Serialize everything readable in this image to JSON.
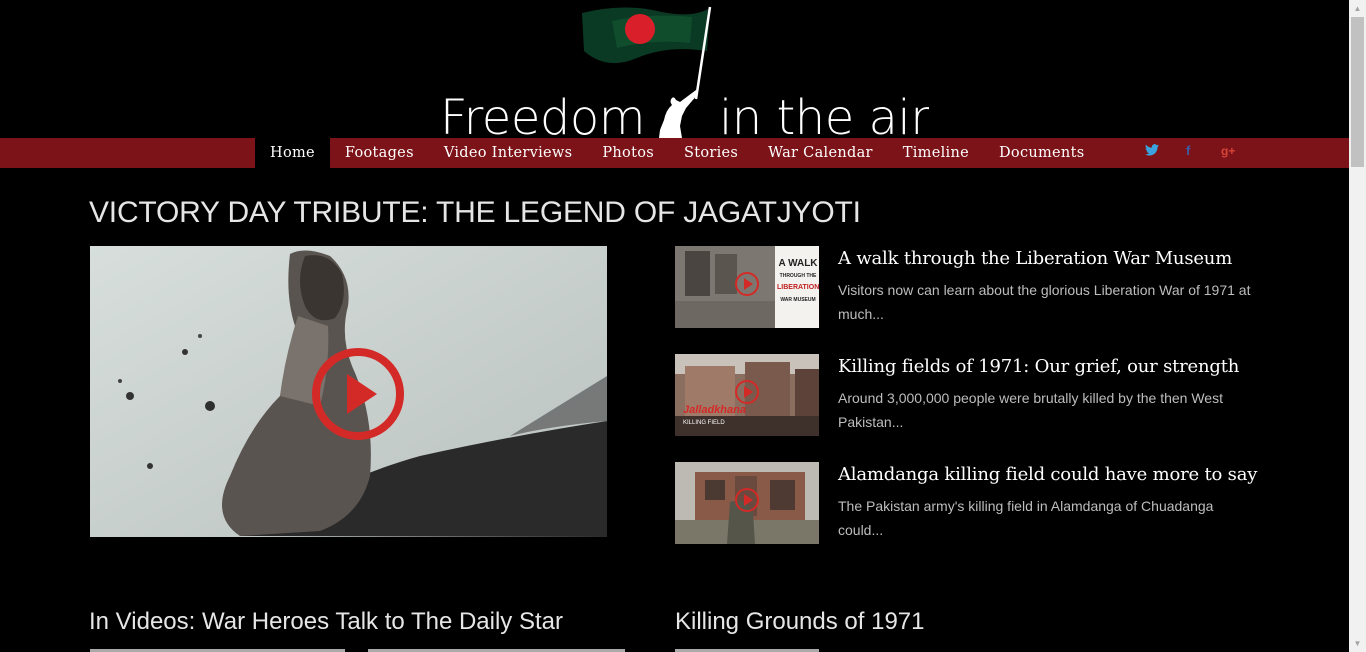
{
  "site": {
    "logo_text_left": "Freedom",
    "logo_text_right": "in the air"
  },
  "nav": {
    "items": [
      {
        "label": "Home",
        "active": true
      },
      {
        "label": "Footages"
      },
      {
        "label": "Video Interviews"
      },
      {
        "label": "Photos"
      },
      {
        "label": "Stories"
      },
      {
        "label": "War Calendar"
      },
      {
        "label": "Timeline"
      },
      {
        "label": "Documents"
      }
    ],
    "social": {
      "twitter": "twitter-icon",
      "facebook": "f",
      "google_plus": "g+"
    }
  },
  "main": {
    "title": "VICTORY DAY TRIBUTE: THE LEGEND OF JAGATJYOTI",
    "stories": [
      {
        "title": "A walk through the Liberation War Museum",
        "desc": "Visitors now can learn about the glorious Liberation War of 1971 at much...",
        "thumb_text": [
          "A WALK",
          "THROUGH THE",
          "LIBERATION",
          "WAR MUSEUM"
        ]
      },
      {
        "title": "Killing fields of 1971: Our grief, our strength",
        "desc": "Around 3,000,000 people were brutally killed by the then West Pakistan...",
        "thumb_text": [
          "Jalladkhana",
          "KILLING FIELD"
        ]
      },
      {
        "title": "Alamdanga killing field could have more to say",
        "desc": "The Pakistan army's killing field in Alamdanga of Chuadanga could..."
      }
    ]
  },
  "sections": [
    {
      "title": "In Videos: War Heroes Talk to The Daily Star"
    },
    {
      "title": "Killing Grounds of 1971"
    }
  ],
  "colors": {
    "nav_bg": "#7b1318",
    "play_red": "#d42a27",
    "flag_green": "#0a4d2f"
  }
}
